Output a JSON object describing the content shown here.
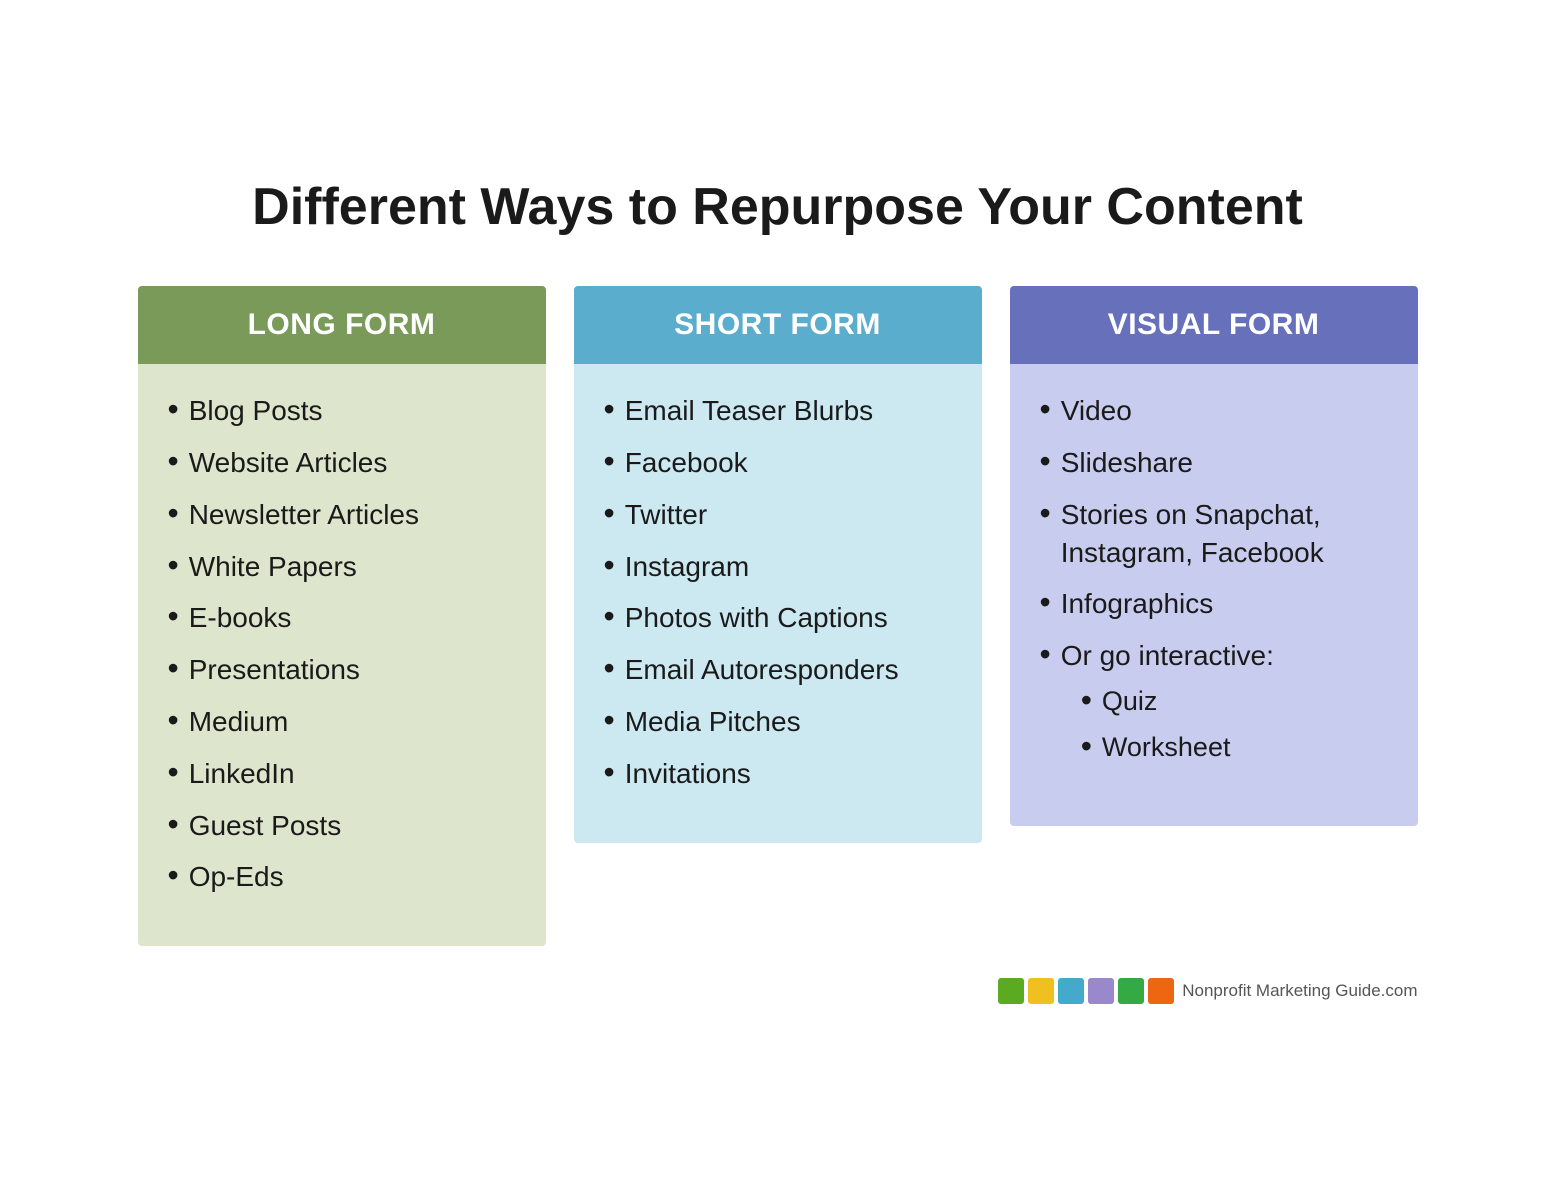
{
  "title": "Different Ways to Repurpose Your Content",
  "columns": [
    {
      "id": "long-form",
      "header": "LONG FORM",
      "items": [
        {
          "text": "Blog Posts"
        },
        {
          "text": "Website Articles"
        },
        {
          "text": "Newsletter Articles"
        },
        {
          "text": "White Papers"
        },
        {
          "text": "E-books"
        },
        {
          "text": "Presentations"
        },
        {
          "text": "Medium"
        },
        {
          "text": "LinkedIn"
        },
        {
          "text": "Guest Posts"
        },
        {
          "text": "Op-Eds"
        }
      ]
    },
    {
      "id": "short-form",
      "header": "SHORT FORM",
      "items": [
        {
          "text": "Email Teaser Blurbs"
        },
        {
          "text": "Facebook"
        },
        {
          "text": "Twitter"
        },
        {
          "text": "Instagram"
        },
        {
          "text": "Photos with Captions"
        },
        {
          "text": "Email Autoresponders"
        },
        {
          "text": "Media Pitches"
        },
        {
          "text": "Invitations"
        }
      ]
    },
    {
      "id": "visual-form",
      "header": "VISUAL FORM",
      "items": [
        {
          "text": "Video"
        },
        {
          "text": "Slideshare"
        },
        {
          "text": "Stories on Snapchat, Instagram, Facebook"
        },
        {
          "text": "Infographics"
        },
        {
          "text": "Or go interactive:",
          "subItems": [
            "Quiz",
            "Worksheet"
          ]
        }
      ]
    }
  ],
  "logo": {
    "blocks": [
      {
        "color": "#5aaa22"
      },
      {
        "color": "#f0c020"
      },
      {
        "color": "#44aacc"
      },
      {
        "color": "#9988cc"
      },
      {
        "color": "#33aa44"
      },
      {
        "color": "#ee6611"
      }
    ],
    "text": "Nonprofit Marketing Guide",
    "suffix": ".com"
  }
}
